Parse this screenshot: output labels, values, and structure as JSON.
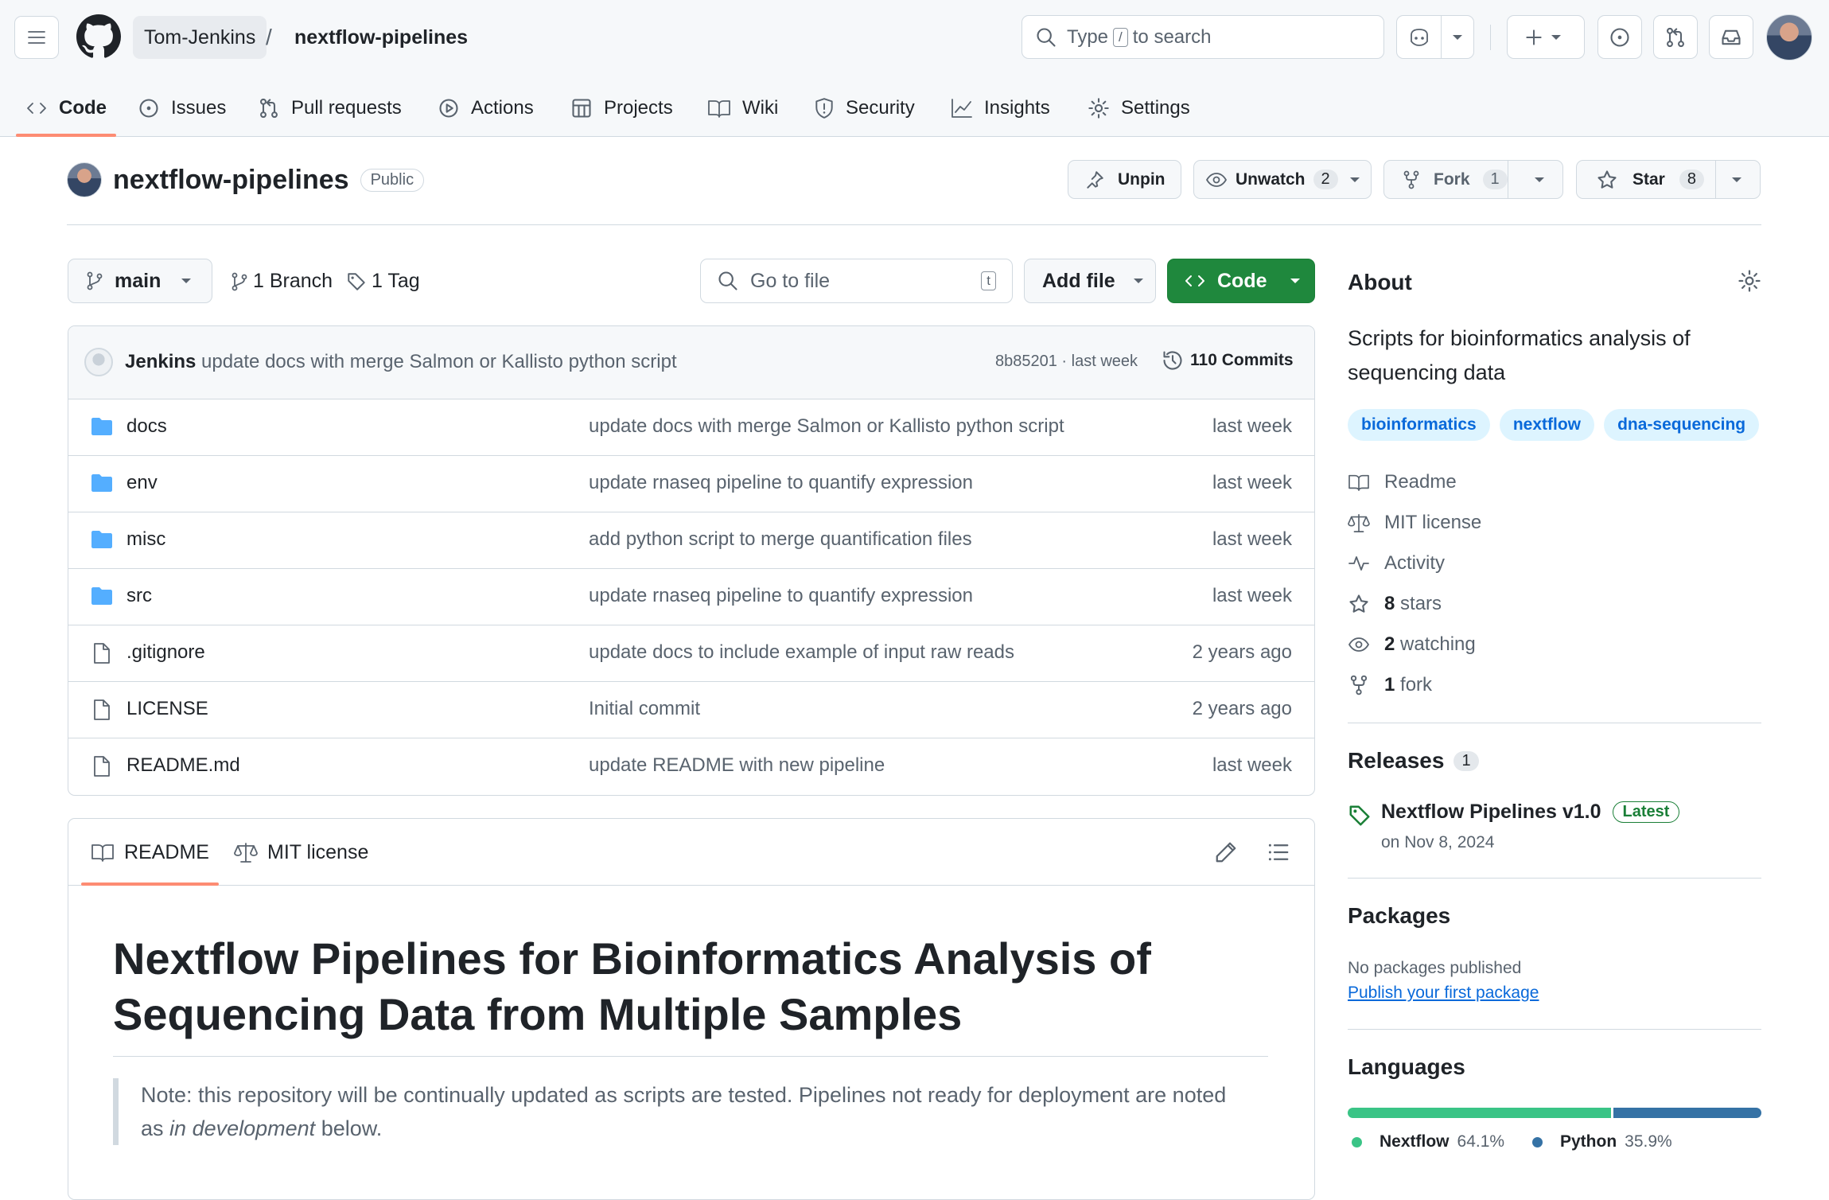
{
  "header": {
    "owner": "Tom-Jenkins",
    "separator": "/",
    "repo": "nextflow-pipelines",
    "search": {
      "before": "Type",
      "key": "/",
      "after": "to search"
    },
    "icons": [
      "hamburger-icon",
      "github-logo-icon",
      "copilot-icon",
      "plus-icon",
      "issues-icon",
      "pull-request-icon",
      "inbox-icon"
    ]
  },
  "tabs": [
    {
      "label": "Code",
      "icon": "code-icon"
    },
    {
      "label": "Issues",
      "icon": "issue-icon"
    },
    {
      "label": "Pull requests",
      "icon": "pull-request-icon"
    },
    {
      "label": "Actions",
      "icon": "play-icon"
    },
    {
      "label": "Projects",
      "icon": "table-icon"
    },
    {
      "label": "Wiki",
      "icon": "book-icon"
    },
    {
      "label": "Security",
      "icon": "shield-icon"
    },
    {
      "label": "Insights",
      "icon": "graph-icon"
    },
    {
      "label": "Settings",
      "icon": "gear-icon"
    }
  ],
  "repo_header": {
    "name": "nextflow-pipelines",
    "visibility": "Public",
    "unpin": "Unpin",
    "unwatch": "Unwatch",
    "watch_count": "2",
    "fork": "Fork",
    "fork_count": "1",
    "star": "Star",
    "star_count": "8"
  },
  "toolbar": {
    "branch": "main",
    "branches": "1 Branch",
    "tags": "1 Tag",
    "goto_placeholder": "Go to file",
    "goto_key": "t",
    "add_file": "Add file",
    "code": "Code"
  },
  "commit": {
    "author": "Jenkins",
    "message": "update docs with merge Salmon or Kallisto python script",
    "hash_time": "8b85201 · last week",
    "commits": "110 Commits"
  },
  "files": [
    {
      "name": "docs",
      "type": "folder",
      "message": "update docs with merge Salmon or Kallisto python script",
      "date": "last week"
    },
    {
      "name": "env",
      "type": "folder",
      "message": "update rnaseq pipeline to quantify expression",
      "date": "last week"
    },
    {
      "name": "misc",
      "type": "folder",
      "message": "add python script to merge quantification files",
      "date": "last week"
    },
    {
      "name": "src",
      "type": "folder",
      "message": "update rnaseq pipeline to quantify expression",
      "date": "last week"
    },
    {
      "name": ".gitignore",
      "type": "file",
      "message": "update docs to include example of input raw reads",
      "date": "2 years ago"
    },
    {
      "name": "LICENSE",
      "type": "file",
      "message": "Initial commit",
      "date": "2 years ago"
    },
    {
      "name": "README.md",
      "type": "file",
      "message": "update README with new pipeline",
      "date": "last week"
    }
  ],
  "readme": {
    "tab_readme": "README",
    "tab_license": "MIT license",
    "title": "Nextflow Pipelines for Bioinformatics Analysis of Sequencing Data from Multiple Samples",
    "note_before": "Note: this repository will be continually updated as scripts are tested. Pipelines not ready for deployment are noted as",
    "note_em": "in development",
    "note_after": "below."
  },
  "about": {
    "heading": "About",
    "description": "Scripts for bioinformatics analysis of sequencing data",
    "topics": [
      "bioinformatics",
      "nextflow",
      "dna-sequencing"
    ],
    "readme": "Readme",
    "license": "MIT license",
    "activity": "Activity",
    "stars_n": "8",
    "stars_label": "stars",
    "watching_n": "2",
    "watching_label": "watching",
    "fork_n": "1",
    "fork_label": "fork"
  },
  "releases": {
    "heading": "Releases",
    "count": "1",
    "name": "Nextflow Pipelines v1.0",
    "badge": "Latest",
    "date": "on Nov 8, 2024"
  },
  "packages": {
    "heading": "Packages",
    "none": "No packages published",
    "link": "Publish your first package"
  },
  "languages": {
    "heading": "Languages",
    "items": [
      {
        "name": "Nextflow",
        "percent": "64.1%",
        "value": 64.1,
        "color": "#3ac486"
      },
      {
        "name": "Python",
        "percent": "35.9%",
        "value": 35.9,
        "color": "#3572a5"
      }
    ]
  },
  "colors": {
    "accent": "#1f883d",
    "tab_underline": "#fd8c73",
    "folder": "#54aeff",
    "link": "#0969da"
  }
}
